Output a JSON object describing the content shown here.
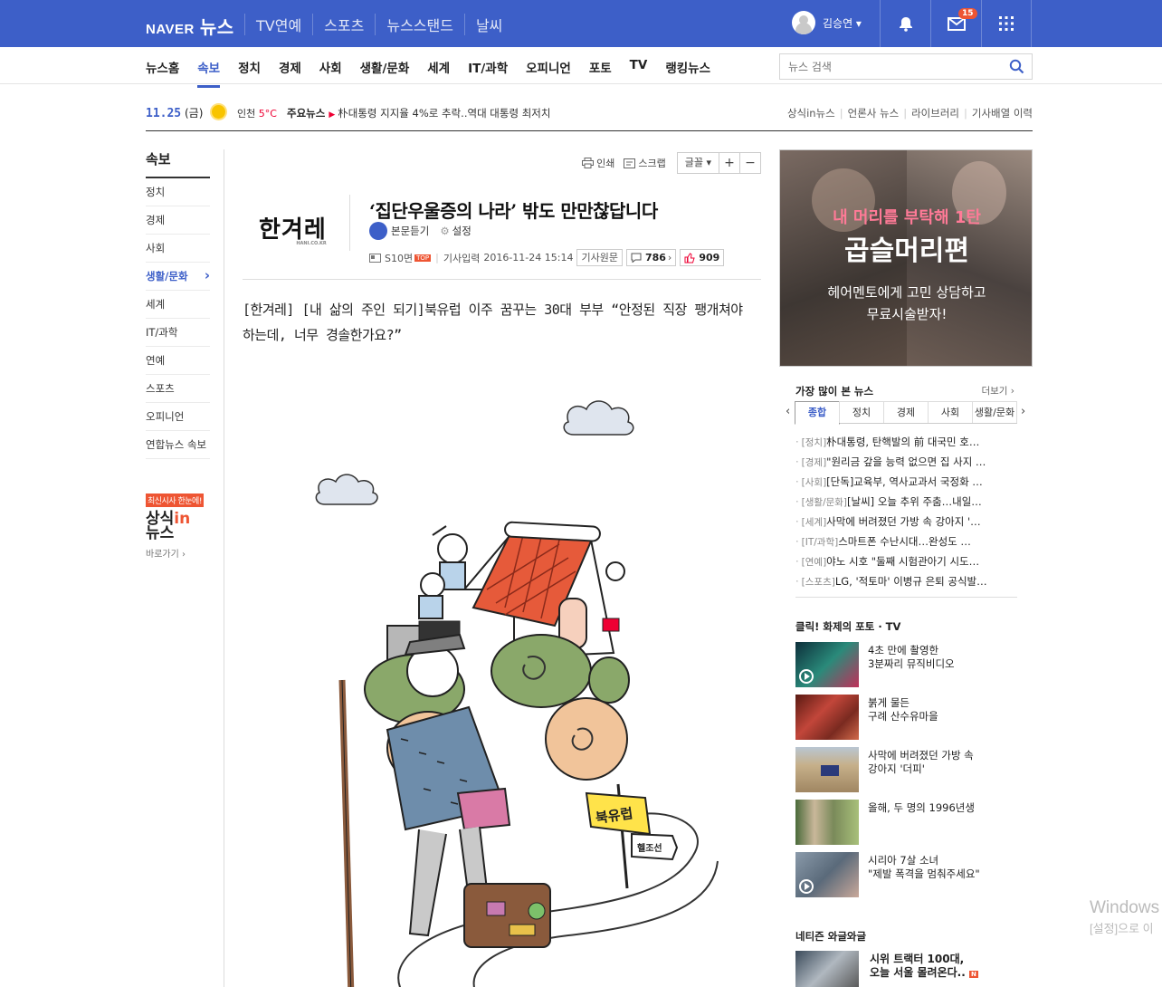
{
  "header": {
    "logo_naver": "NAVER",
    "logo_news": "뉴스",
    "top_nav": [
      "TV연예",
      "스포츠",
      "뉴스스탠드",
      "날씨"
    ],
    "user_name": "김승연 ▾",
    "mail_count": "15"
  },
  "subnav": {
    "items": [
      "뉴스홈",
      "속보",
      "정치",
      "경제",
      "사회",
      "생활/문화",
      "세계",
      "IT/과학",
      "오피니언",
      "포토",
      "TV",
      "랭킹뉴스"
    ],
    "active": "속보",
    "search_placeholder": "뉴스 검색"
  },
  "infobar": {
    "date": "11.25",
    "day": "(금)",
    "city": "인천",
    "temp": "5°C",
    "headline_label": "주요뉴스",
    "headline": "朴대통령 지지율 4%로 추락..역대 대통령 최저치",
    "links": [
      "상식in뉴스",
      "언론사 뉴스",
      "라이브러리",
      "기사배열 이력"
    ]
  },
  "sidebar": {
    "title": "속보",
    "items": [
      "정치",
      "경제",
      "사회",
      "생활/문화",
      "세계",
      "IT/과학",
      "연예",
      "스포츠",
      "오피니언",
      "연합뉴스 속보"
    ],
    "promo_tag": "최신시사 한눈에!",
    "promo_logo_a": "상식",
    "promo_logo_b": "in",
    "promo_logo_c": "뉴스",
    "promo_go": "바로가기 ›"
  },
  "article": {
    "tools": {
      "print": "인쇄",
      "scrap": "스크랩",
      "font": "글꼴 ▾",
      "plus": "+",
      "minus": "−"
    },
    "press": "한겨레",
    "press_sub": "HANI.CO.KR",
    "title": "‘집단우울증의 나라’ 밖도 만만찮답니다",
    "audio": "본문듣기",
    "settings": "설정",
    "page": "S10면",
    "top_badge": "TOP",
    "input_label": "기사입력",
    "input_time": "2016-11-24 15:14",
    "origin": "기사원문",
    "comments": "786",
    "likes": "909",
    "lead": "[한겨레] [내 삶의 주인 되기]북유럽 이주 꿈꾸는 30대 부부 “안정된 직장 팽개쳐야 하는데, 너무 경솔한가요?”",
    "sign_a": "북유럽",
    "sign_b": "헬조선"
  },
  "ad": {
    "line1": "내 머리를 부탁해 1탄",
    "line2": "곱슬머리편",
    "line3a": "헤어멘토에게 고민 상담하고",
    "line3b": "무료시술받자!"
  },
  "most_viewed": {
    "title": "가장 많이 본 뉴스",
    "more": "더보기 ›",
    "tabs": [
      "종합",
      "정치",
      "경제",
      "사회",
      "생활/문화"
    ],
    "items": [
      {
        "cat": "[정치]",
        "text": "朴대통령, 탄핵발의 前 대국민 호…"
      },
      {
        "cat": "[경제]",
        "text": "\"원리금 갚을 능력 없으면 집 사지 …"
      },
      {
        "cat": "[사회]",
        "text": "[단독]교육부, 역사교과서 국정화 …"
      },
      {
        "cat": "[생활/문화]",
        "text": "[날씨] 오늘 추위 주춤…내일…"
      },
      {
        "cat": "[세계]",
        "text": "사막에 버려졌던 가방 속 강아지 '…"
      },
      {
        "cat": "[IT/과학]",
        "text": "스마트폰 수난시대…완성도 …"
      },
      {
        "cat": "[연예]",
        "text": "야노 시호 \"둘째 시험관아기 시도…"
      },
      {
        "cat": "[스포츠]",
        "text": "LG, '적토마' 이병규 은퇴 공식발…"
      }
    ]
  },
  "photo_tv": {
    "title": "클릭! 화제의 포토 · TV",
    "items": [
      {
        "line1": "4초 만에 촬영한",
        "line2": "3분짜리 뮤직비디오",
        "video": true,
        "color": "#1a3a4a"
      },
      {
        "line1": "붉게 물든",
        "line2": "구례 산수유마을",
        "video": false,
        "color": "#8a2a22"
      },
      {
        "line1": "사막에 버려졌던 가방 속",
        "line2": "강아지 '더피'",
        "video": false,
        "color": "#a08662"
      },
      {
        "line1": "올해, 두 명의 1996년생",
        "line2": "",
        "video": false,
        "color": "#6a8a4a"
      },
      {
        "line1": "시리아 7살 소녀",
        "line2": "\"제발 폭격을 멈춰주세요\"",
        "video": true,
        "color": "#5a6a7a"
      }
    ]
  },
  "netizen": {
    "title": "네티즌 와글와글",
    "line1": "시위 트랙터 100대,",
    "line2": "오늘 서울 몰려온다..",
    "new_badge": "N"
  },
  "watermark": {
    "line1": "Windows",
    "line2": "[설정]으로 이"
  }
}
